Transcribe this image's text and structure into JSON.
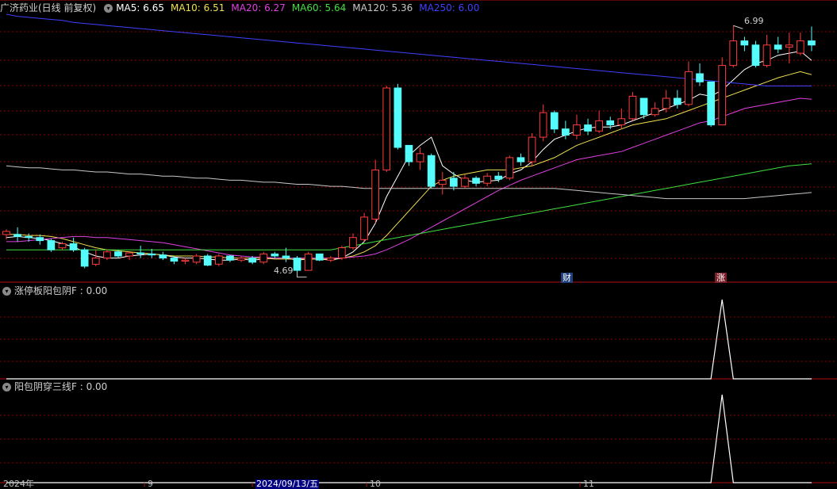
{
  "header": {
    "stock_title": "广济药业(日线 前复权)",
    "ma": [
      {
        "label": "MA5: 6.65",
        "color": "#ffffff"
      },
      {
        "label": "MA10: 6.51",
        "color": "#f0e050"
      },
      {
        "label": "MA20: 6.27",
        "color": "#e040e0"
      },
      {
        "label": "MA60: 5.64",
        "color": "#40e040"
      },
      {
        "label": "MA120: 5.36",
        "color": "#c8c8c8"
      },
      {
        "label": "MA250: 6.00",
        "color": "#4040ff"
      }
    ]
  },
  "panel2": {
    "title": "涨停板阳包阴F : 0.00"
  },
  "panel3": {
    "title": "阳包阴穿三线F : 0.00"
  },
  "badges": {
    "cai": "财",
    "zhang": "涨"
  },
  "annotations": {
    "high": "6.99",
    "low": "4.69"
  },
  "xaxis": {
    "labels": [
      "2024年",
      "9",
      "2024/09/13/五",
      "10",
      "11"
    ]
  },
  "colors": {
    "up": "#ff3c3c",
    "down": "#54fcfc",
    "ma5": "#ffffff",
    "ma10": "#f0e050",
    "ma20": "#e040e0",
    "ma60": "#40e040",
    "ma120": "#c8c8c8",
    "ma250": "#4040ff",
    "grid": "#8b0000",
    "border": "#b01010"
  },
  "chart_data": [
    {
      "type": "candlestick",
      "title": "广济药业(日线 前复权)",
      "series_ohlc": [
        [
          4.95,
          4.98,
          4.9,
          5.0
        ],
        [
          4.95,
          4.93,
          4.88,
          5.02
        ],
        [
          4.93,
          4.92,
          4.88,
          4.96
        ],
        [
          4.92,
          4.89,
          4.85,
          4.95
        ],
        [
          4.89,
          4.8,
          4.78,
          4.91
        ],
        [
          4.82,
          4.86,
          4.8,
          4.88
        ],
        [
          4.86,
          4.8,
          4.78,
          4.92
        ],
        [
          4.8,
          4.64,
          4.62,
          4.82
        ],
        [
          4.66,
          4.72,
          4.64,
          4.8
        ],
        [
          4.72,
          4.78,
          4.7,
          4.8
        ],
        [
          4.78,
          4.74,
          4.72,
          4.8
        ],
        [
          4.74,
          4.77,
          4.7,
          4.78
        ],
        [
          4.77,
          4.76,
          4.72,
          4.84
        ],
        [
          4.76,
          4.75,
          4.72,
          4.81
        ],
        [
          4.75,
          4.72,
          4.7,
          4.78
        ],
        [
          4.72,
          4.69,
          4.66,
          4.74
        ],
        [
          4.69,
          4.7,
          4.66,
          4.72
        ],
        [
          4.68,
          4.74,
          4.66,
          4.76
        ],
        [
          4.74,
          4.65,
          4.64,
          4.76
        ],
        [
          4.66,
          4.74,
          4.64,
          4.76
        ],
        [
          4.74,
          4.7,
          4.68,
          4.75
        ],
        [
          4.7,
          4.72,
          4.68,
          4.74
        ],
        [
          4.72,
          4.68,
          4.66,
          4.74
        ],
        [
          4.68,
          4.76,
          4.66,
          4.78
        ],
        [
          4.76,
          4.74,
          4.72,
          4.78
        ],
        [
          4.74,
          4.72,
          4.68,
          4.82
        ],
        [
          4.72,
          4.6,
          4.58,
          4.74
        ],
        [
          4.6,
          4.76,
          4.6,
          4.78
        ],
        [
          4.76,
          4.7,
          4.69,
          4.76
        ],
        [
          4.7,
          4.72,
          4.68,
          4.74
        ],
        [
          4.72,
          4.82,
          4.7,
          4.84
        ],
        [
          4.82,
          4.92,
          4.8,
          4.96
        ],
        [
          4.9,
          5.12,
          4.88,
          5.16
        ],
        [
          5.1,
          5.58,
          5.06,
          5.68
        ],
        [
          5.58,
          6.38,
          5.56,
          6.4
        ],
        [
          6.38,
          5.8,
          5.78,
          6.42
        ],
        [
          5.82,
          5.66,
          5.62,
          5.7
        ],
        [
          5.66,
          5.74,
          5.58,
          5.8
        ],
        [
          5.72,
          5.42,
          5.4,
          5.74
        ],
        [
          5.44,
          5.48,
          5.34,
          5.56
        ],
        [
          5.5,
          5.42,
          5.38,
          5.56
        ],
        [
          5.42,
          5.5,
          5.4,
          5.54
        ],
        [
          5.5,
          5.45,
          5.42,
          5.52
        ],
        [
          5.45,
          5.52,
          5.42,
          5.55
        ],
        [
          5.52,
          5.49,
          5.46,
          5.56
        ],
        [
          5.5,
          5.7,
          5.48,
          5.72
        ],
        [
          5.7,
          5.66,
          5.62,
          5.74
        ],
        [
          5.66,
          5.9,
          5.62,
          5.94
        ],
        [
          5.9,
          6.14,
          5.86,
          6.22
        ],
        [
          6.14,
          5.98,
          5.94,
          6.16
        ],
        [
          5.98,
          5.92,
          5.88,
          6.06
        ],
        [
          5.92,
          6.02,
          5.88,
          6.12
        ],
        [
          6.02,
          5.96,
          5.92,
          6.08
        ],
        [
          5.96,
          6.06,
          5.94,
          6.16
        ],
        [
          6.06,
          6.02,
          5.98,
          6.1
        ],
        [
          6.02,
          6.08,
          5.98,
          6.18
        ],
        [
          6.08,
          6.3,
          6.06,
          6.34
        ],
        [
          6.28,
          6.12,
          6.08,
          6.28
        ],
        [
          6.12,
          6.18,
          6.1,
          6.24
        ],
        [
          6.18,
          6.28,
          6.14,
          6.36
        ],
        [
          6.28,
          6.22,
          6.18,
          6.36
        ],
        [
          6.22,
          6.54,
          6.2,
          6.64
        ],
        [
          6.52,
          6.44,
          6.4,
          6.62
        ],
        [
          6.44,
          6.02,
          6.0,
          6.44
        ],
        [
          6.02,
          6.6,
          6.02,
          6.68
        ],
        [
          6.6,
          6.84,
          6.58,
          6.99
        ],
        [
          6.84,
          6.8,
          6.74,
          6.88
        ],
        [
          6.8,
          6.6,
          6.58,
          6.84
        ],
        [
          6.6,
          6.8,
          6.58,
          6.9
        ],
        [
          6.8,
          6.76,
          6.72,
          6.88
        ],
        [
          6.78,
          6.8,
          6.62,
          6.92
        ],
        [
          6.72,
          6.84,
          6.7,
          6.92
        ],
        [
          6.84,
          6.8,
          6.74,
          6.98
        ]
      ],
      "ma": {
        "MA5": [
          4.92,
          4.93,
          4.92,
          4.91,
          4.89,
          4.86,
          4.83,
          4.78,
          4.74,
          4.72,
          4.72,
          4.74,
          4.75,
          4.76,
          4.75,
          4.73,
          4.72,
          4.72,
          4.71,
          4.7,
          4.7,
          4.71,
          4.7,
          4.71,
          4.72,
          4.72,
          4.7,
          4.71,
          4.71,
          4.7,
          4.72,
          4.78,
          4.88,
          5.06,
          5.32,
          5.52,
          5.72,
          5.82,
          5.9,
          5.62,
          5.54,
          5.48,
          5.46,
          5.47,
          5.48,
          5.54,
          5.58,
          5.66,
          5.78,
          5.88,
          5.92,
          5.96,
          5.99,
          6.0,
          6.0,
          6.02,
          6.06,
          6.1,
          6.14,
          6.18,
          6.22,
          6.26,
          6.32,
          6.3,
          6.36,
          6.46,
          6.56,
          6.62,
          6.65,
          6.7,
          6.72,
          6.74,
          6.65
        ],
        "MA10": [
          4.95,
          4.95,
          4.94,
          4.94,
          4.93,
          4.91,
          4.88,
          4.85,
          4.82,
          4.8,
          4.79,
          4.78,
          4.77,
          4.76,
          4.75,
          4.74,
          4.74,
          4.74,
          4.73,
          4.73,
          4.72,
          4.72,
          4.72,
          4.72,
          4.71,
          4.71,
          4.71,
          4.71,
          4.71,
          4.71,
          4.72,
          4.74,
          4.78,
          4.84,
          4.94,
          5.06,
          5.18,
          5.3,
          5.42,
          5.48,
          5.52,
          5.54,
          5.56,
          5.58,
          5.58,
          5.58,
          5.6,
          5.62,
          5.66,
          5.7,
          5.76,
          5.82,
          5.86,
          5.9,
          5.94,
          5.98,
          6.02,
          6.04,
          6.06,
          6.08,
          6.12,
          6.16,
          6.2,
          6.24,
          6.28,
          6.32,
          6.36,
          6.4,
          6.44,
          6.48,
          6.51,
          6.54,
          6.51
        ],
        "MA20": [
          4.88,
          4.88,
          4.89,
          4.9,
          4.91,
          4.92,
          4.93,
          4.93,
          4.92,
          4.92,
          4.91,
          4.9,
          4.89,
          4.88,
          4.87,
          4.85,
          4.83,
          4.81,
          4.79,
          4.77,
          4.75,
          4.74,
          4.73,
          4.73,
          4.72,
          4.72,
          4.72,
          4.72,
          4.72,
          4.72,
          4.72,
          4.73,
          4.74,
          4.76,
          4.8,
          4.85,
          4.9,
          4.96,
          5.02,
          5.08,
          5.14,
          5.2,
          5.26,
          5.32,
          5.38,
          5.43,
          5.48,
          5.52,
          5.56,
          5.6,
          5.64,
          5.68,
          5.7,
          5.72,
          5.74,
          5.76,
          5.8,
          5.84,
          5.88,
          5.92,
          5.96,
          6.0,
          6.04,
          6.06,
          6.1,
          6.14,
          6.18,
          6.2,
          6.22,
          6.24,
          6.26,
          6.28,
          6.27
        ],
        "MA60": [
          4.8,
          4.8,
          4.8,
          4.8,
          4.8,
          4.8,
          4.8,
          4.8,
          4.8,
          4.8,
          4.8,
          4.8,
          4.8,
          4.8,
          4.8,
          4.8,
          4.8,
          4.8,
          4.8,
          4.8,
          4.8,
          4.8,
          4.8,
          4.8,
          4.8,
          4.8,
          4.8,
          4.8,
          4.8,
          4.8,
          4.82,
          4.84,
          4.86,
          4.88,
          4.9,
          4.92,
          4.94,
          4.96,
          4.98,
          5.0,
          5.02,
          5.04,
          5.06,
          5.08,
          5.1,
          5.12,
          5.14,
          5.16,
          5.18,
          5.2,
          5.22,
          5.24,
          5.26,
          5.28,
          5.3,
          5.32,
          5.34,
          5.36,
          5.38,
          5.4,
          5.42,
          5.44,
          5.46,
          5.48,
          5.5,
          5.52,
          5.54,
          5.56,
          5.58,
          5.6,
          5.62,
          5.63,
          5.64
        ],
        "MA120": [
          5.62,
          5.61,
          5.6,
          5.6,
          5.59,
          5.58,
          5.58,
          5.57,
          5.56,
          5.56,
          5.55,
          5.54,
          5.54,
          5.53,
          5.52,
          5.52,
          5.51,
          5.5,
          5.5,
          5.49,
          5.48,
          5.48,
          5.47,
          5.46,
          5.46,
          5.45,
          5.44,
          5.44,
          5.43,
          5.42,
          5.42,
          5.41,
          5.4,
          5.4,
          5.4,
          5.4,
          5.4,
          5.4,
          5.4,
          5.4,
          5.4,
          5.4,
          5.4,
          5.4,
          5.4,
          5.4,
          5.4,
          5.4,
          5.4,
          5.4,
          5.39,
          5.38,
          5.37,
          5.36,
          5.35,
          5.34,
          5.33,
          5.32,
          5.31,
          5.3,
          5.3,
          5.3,
          5.3,
          5.3,
          5.3,
          5.3,
          5.3,
          5.31,
          5.32,
          5.33,
          5.34,
          5.35,
          5.36
        ],
        "MA250": [
          7.1,
          7.08,
          7.07,
          7.06,
          7.05,
          7.04,
          7.02,
          7.01,
          7.0,
          6.99,
          6.98,
          6.97,
          6.96,
          6.95,
          6.94,
          6.93,
          6.92,
          6.91,
          6.9,
          6.89,
          6.88,
          6.87,
          6.86,
          6.85,
          6.84,
          6.83,
          6.82,
          6.81,
          6.8,
          6.79,
          6.78,
          6.77,
          6.76,
          6.75,
          6.74,
          6.73,
          6.72,
          6.71,
          6.7,
          6.69,
          6.68,
          6.67,
          6.66,
          6.65,
          6.64,
          6.63,
          6.62,
          6.61,
          6.6,
          6.59,
          6.58,
          6.57,
          6.56,
          6.55,
          6.54,
          6.53,
          6.52,
          6.51,
          6.5,
          6.49,
          6.48,
          6.47,
          6.46,
          6.45,
          6.44,
          6.43,
          6.42,
          6.41,
          6.4,
          6.4,
          6.4,
          6.4,
          6.4
        ]
      },
      "ylim": [
        4.5,
        7.1
      ]
    },
    {
      "type": "line",
      "title": "涨停板阳包阴F",
      "y": [
        0,
        0,
        0,
        0,
        0,
        0,
        0,
        0,
        0,
        0,
        0,
        0,
        0,
        0,
        0,
        0,
        0,
        0,
        0,
        0,
        0,
        0,
        0,
        0,
        0,
        0,
        0,
        0,
        0,
        0,
        0,
        0,
        0,
        0,
        0,
        0,
        0,
        0,
        0,
        0,
        0,
        0,
        0,
        0,
        0,
        0,
        0,
        0,
        0,
        0,
        0,
        0,
        0,
        0,
        0,
        0,
        0,
        0,
        0,
        0,
        0,
        0,
        0,
        0,
        1,
        0,
        0,
        0,
        0,
        0,
        0,
        0,
        0
      ],
      "ylim": [
        0,
        1
      ]
    },
    {
      "type": "line",
      "title": "阳包阴穿三线F",
      "y": [
        0,
        0,
        0,
        0,
        0,
        0,
        0,
        0,
        0,
        0,
        0,
        0,
        0,
        0,
        0,
        0,
        0,
        0,
        0,
        0,
        0,
        0,
        0,
        0,
        0,
        0,
        0,
        0,
        0,
        0,
        0,
        0,
        0,
        0,
        0,
        0,
        0,
        0,
        0,
        0,
        0,
        0,
        0,
        0,
        0,
        0,
        0,
        0,
        0,
        0,
        0,
        0,
        0,
        0,
        0,
        0,
        0,
        0,
        0,
        0,
        0,
        0,
        0,
        0,
        1,
        0,
        0,
        0,
        0,
        0,
        0,
        0,
        0
      ],
      "ylim": [
        0,
        1
      ]
    }
  ]
}
